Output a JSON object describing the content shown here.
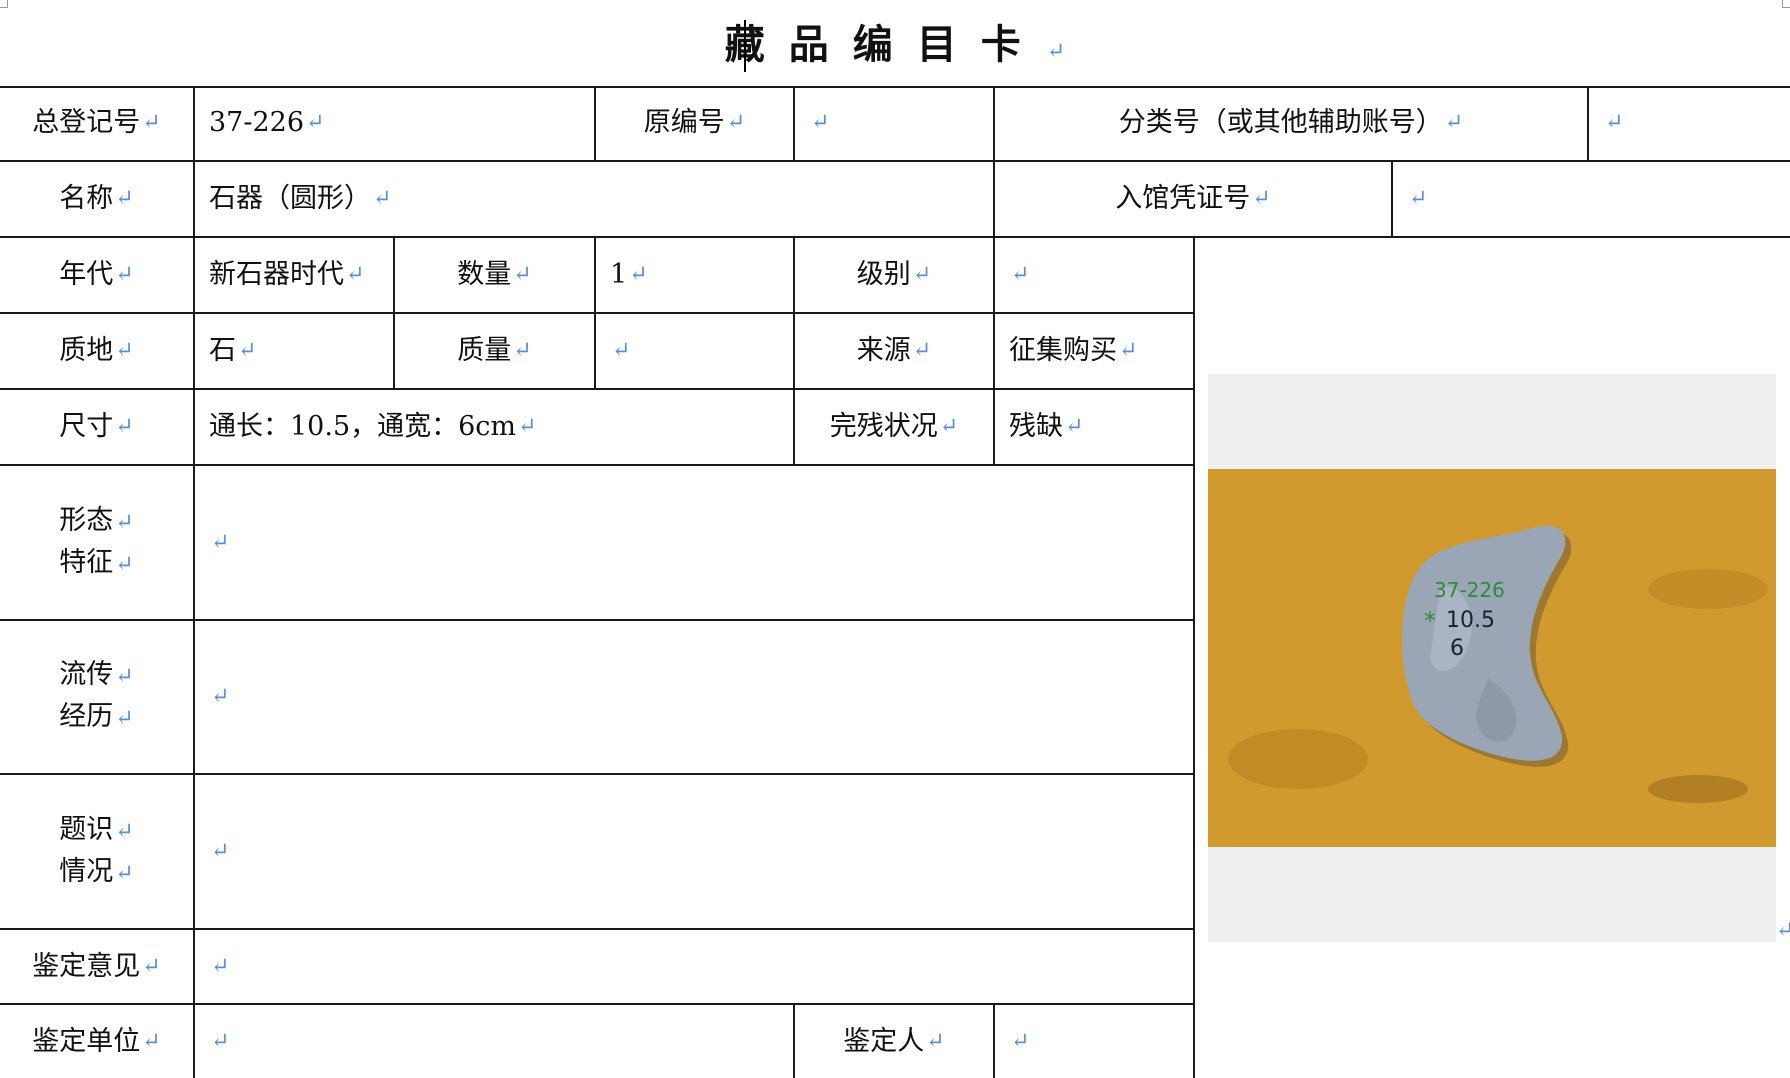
{
  "title": "藏品编目卡",
  "return_mark": "↵",
  "rows": {
    "registration_no_label": "总登记号",
    "registration_no": "37-226",
    "original_no_label": "原编号",
    "original_no": "",
    "classification_label": "分类号（或其他辅助账号）",
    "classification": "",
    "name_label": "名称",
    "name": "石器（圆形）",
    "entry_voucher_label": "入馆凭证号",
    "entry_voucher": "",
    "period_label": "年代",
    "period": "新石器时代",
    "quantity_label": "数量",
    "quantity": "1",
    "grade_label": "级别",
    "grade": "",
    "material_label": "质地",
    "material": "石",
    "weight_label": "质量",
    "weight": "",
    "source_label": "来源",
    "source": "征集购买",
    "size_label": "尺寸",
    "size": "通长：10.5，通宽：6cm",
    "condition_label": "完残状况",
    "condition": "残缺",
    "form_label_1": "形态",
    "form_label_2": "特征",
    "form": "",
    "provenance_label_1": "流传",
    "provenance_label_2": "经历",
    "provenance": "",
    "inscription_label_1": "题识",
    "inscription_label_2": "情况",
    "inscription": "",
    "appraisal_opinion_label": "鉴定意见",
    "appraisal_opinion": "",
    "appraisal_unit_label": "鉴定单位",
    "appraisal_unit": "",
    "appraiser_label": "鉴定人",
    "appraiser": ""
  },
  "photo": {
    "specimen_marks": [
      "37-226",
      "10.5",
      "6"
    ],
    "background_color": "#d7a235",
    "stone_color": "#9aa6b6"
  }
}
